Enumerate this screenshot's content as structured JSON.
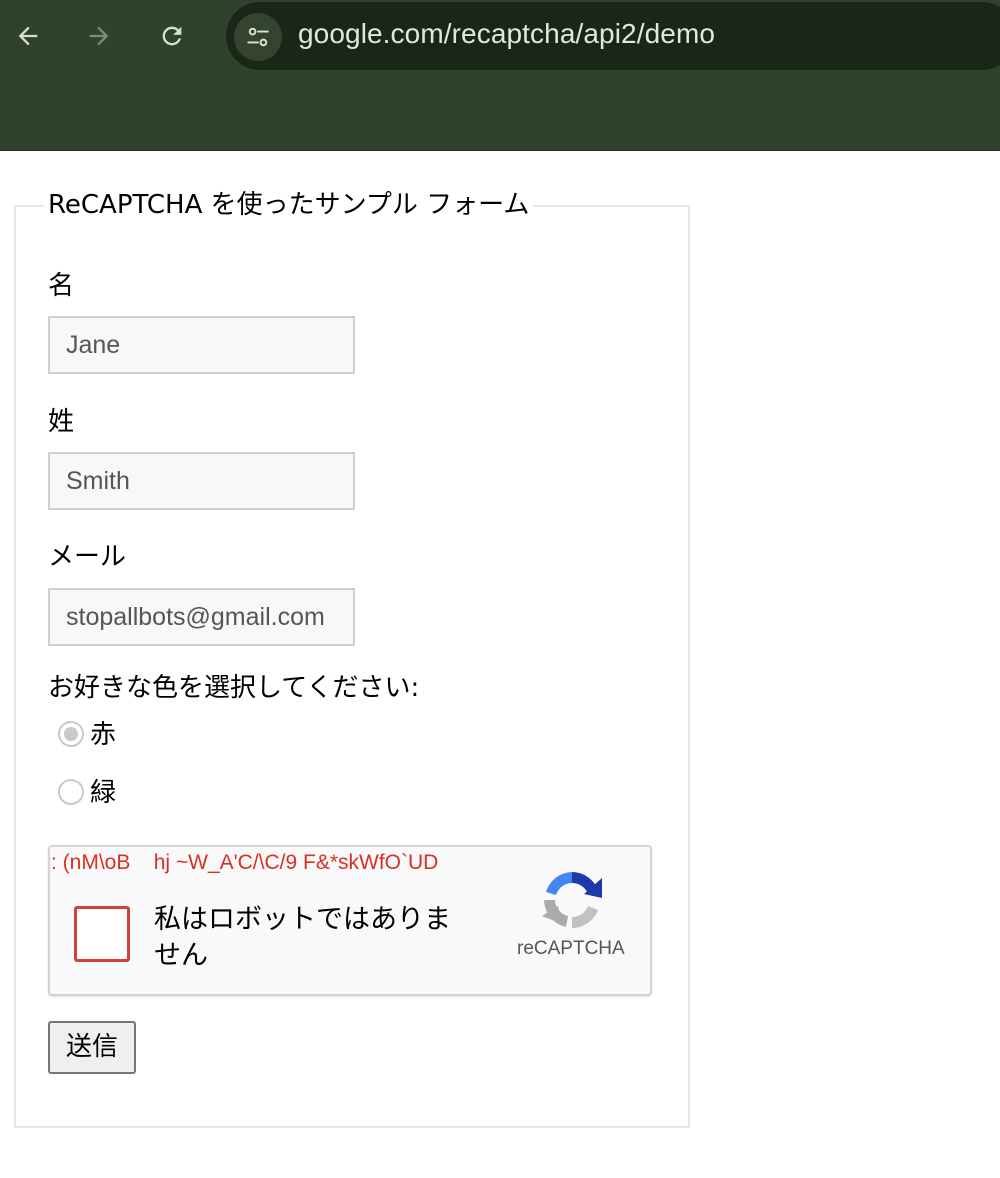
{
  "browser": {
    "back_icon": "arrow-left-icon",
    "forward_icon": "arrow-right-icon",
    "reload_icon": "reload-icon",
    "site_info_icon": "tune-icon",
    "url": "google.com/recaptcha/api2/demo"
  },
  "form": {
    "legend": "ReCAPTCHA を使ったサンプル フォーム",
    "first_name": {
      "label": "名",
      "value": "Jane"
    },
    "last_name": {
      "label": "姓",
      "value": "Smith"
    },
    "email": {
      "label": "メール",
      "value": "stopallbots@gmail.com"
    },
    "color_prompt": "お好きな色を選択してください:",
    "colors": [
      {
        "label": "赤",
        "checked": true
      },
      {
        "label": "緑",
        "checked": false
      }
    ],
    "recaptcha": {
      "error_text": ": (nM\\oB    hj ~W_A'C/\\C/9 F&*skWfO`UD",
      "checkbox_label": "私はロボットではありません",
      "brand": "reCAPTCHA",
      "checked": false
    },
    "submit_label": "送信"
  }
}
